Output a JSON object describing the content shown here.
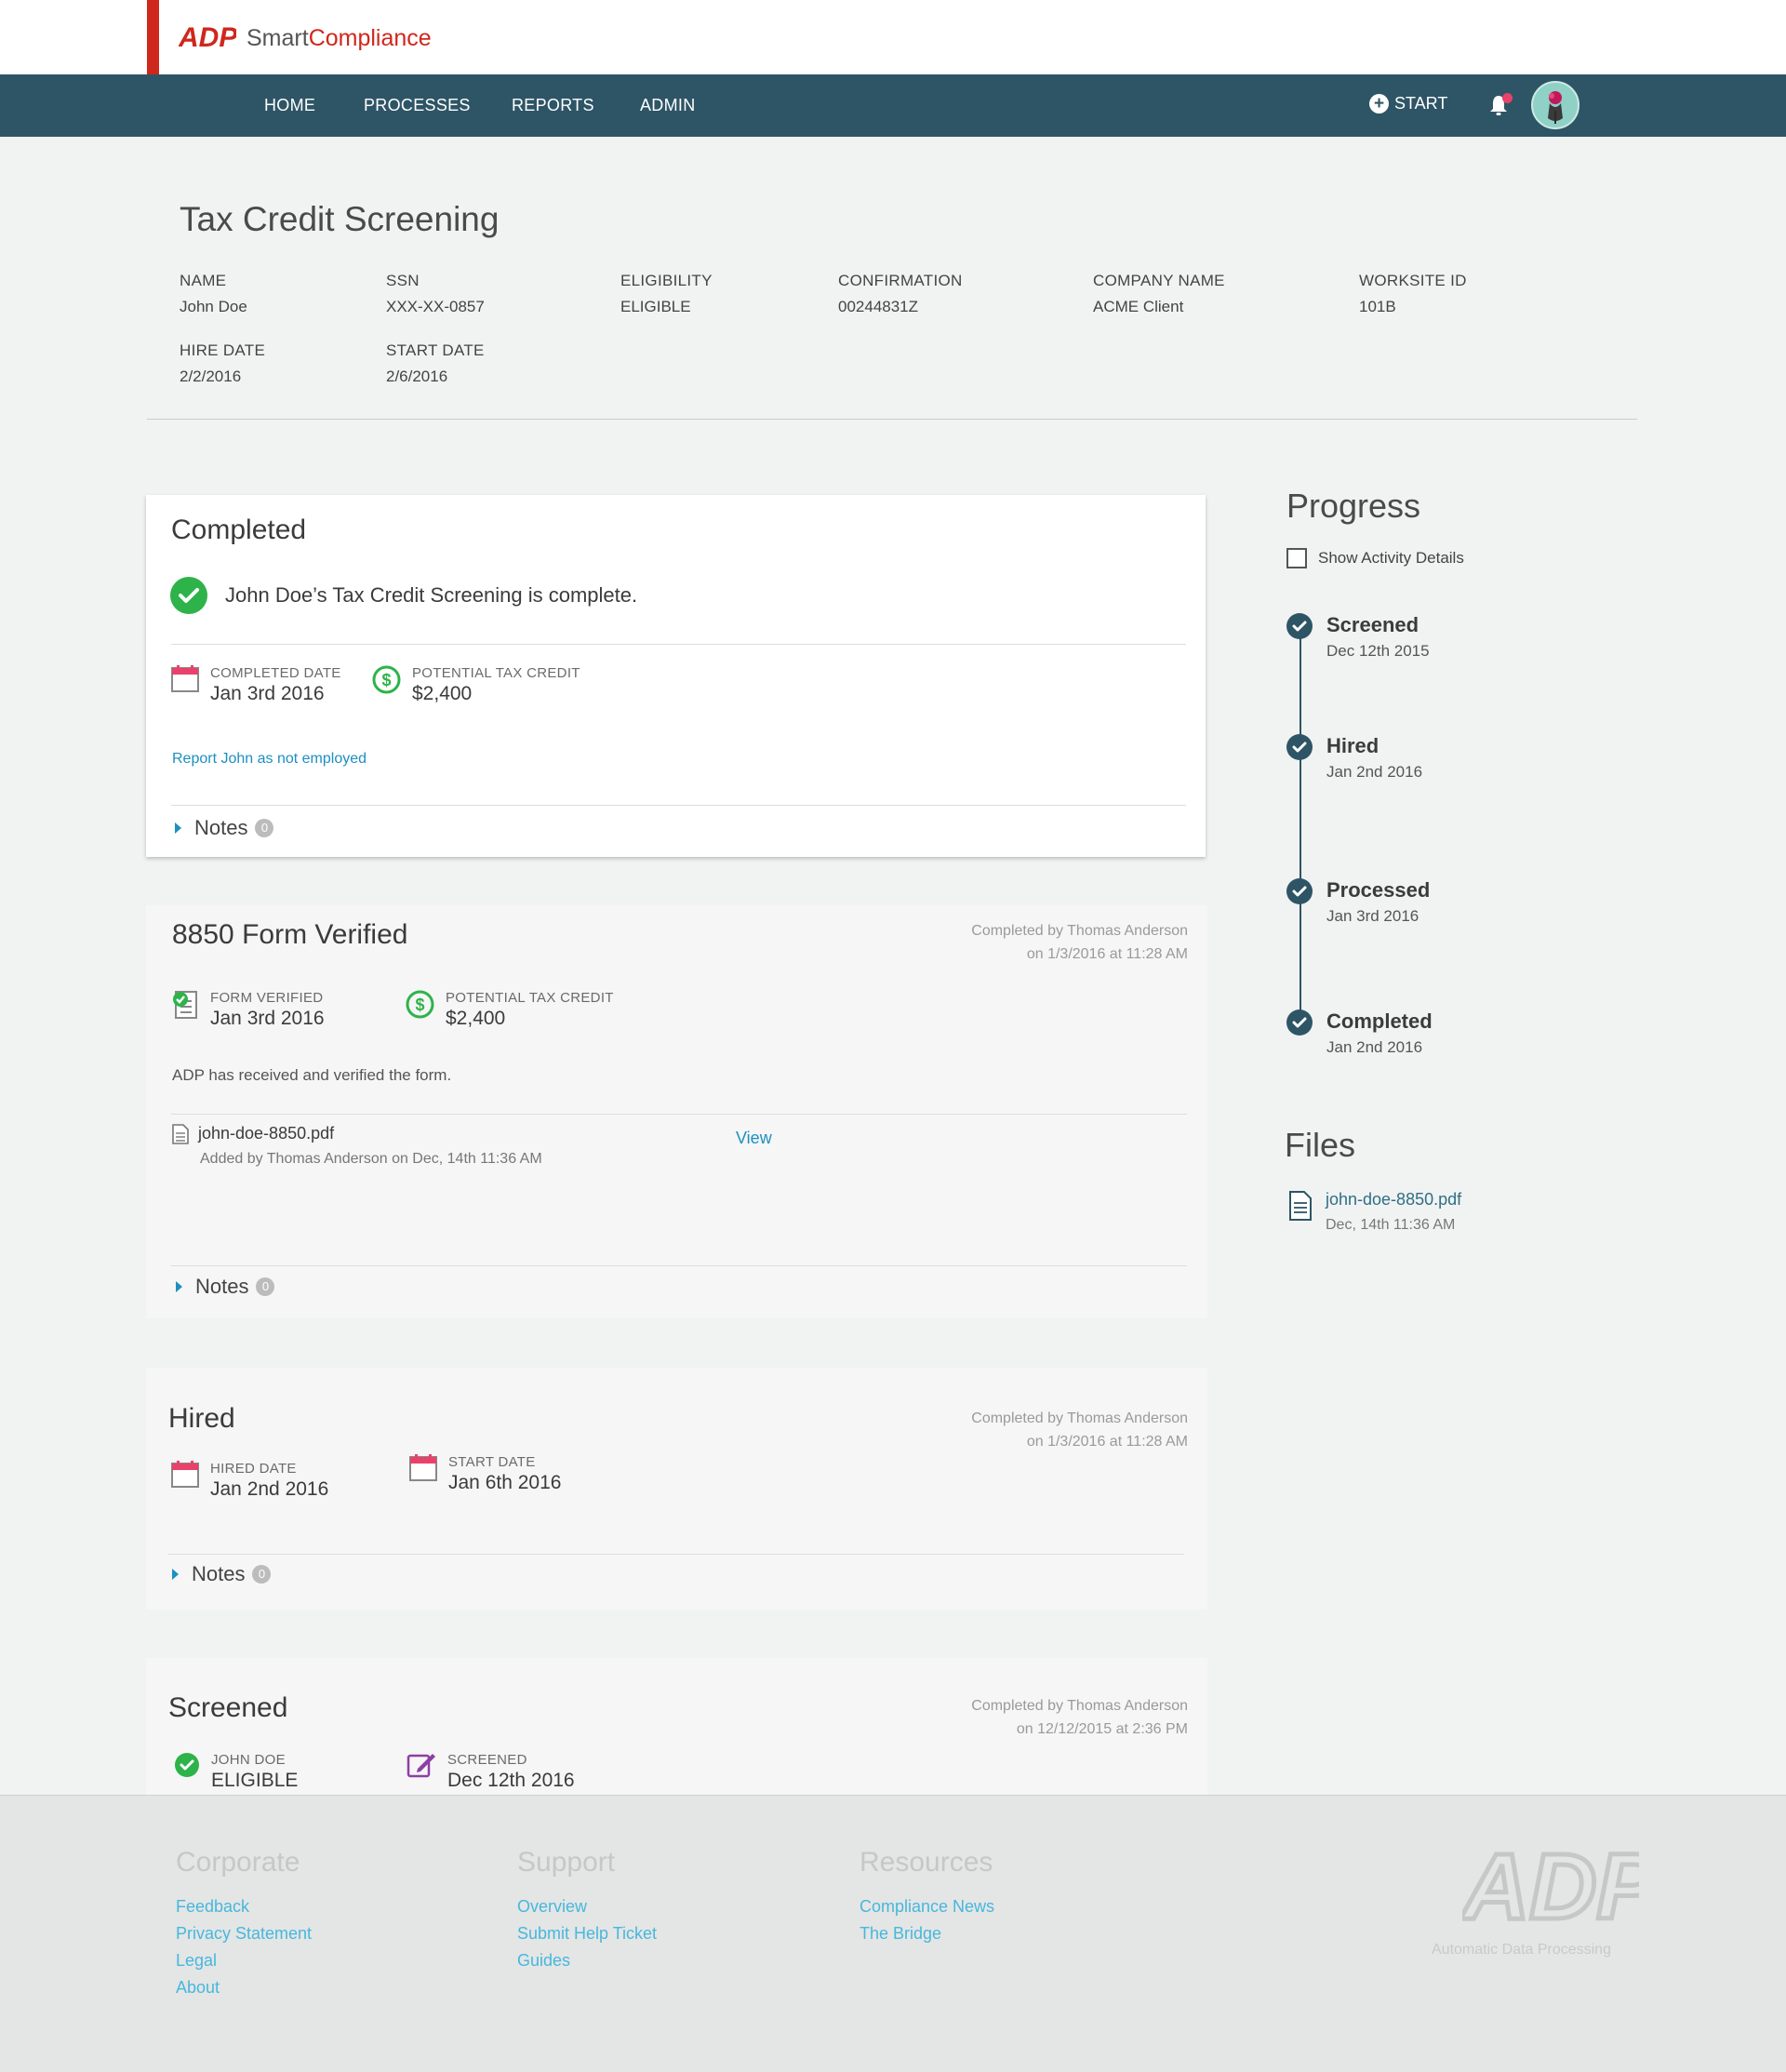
{
  "brand": {
    "prefix": "Smart",
    "accent": "Compliance",
    "logo": "ADP",
    "accent_color": "#d0271d"
  },
  "nav": {
    "items": [
      "HOME",
      "PROCESSES",
      "REPORTS",
      "ADMIN"
    ],
    "start_label": "START",
    "nav_color": "#2e5566"
  },
  "header": {
    "title": "Tax Credit Screening",
    "fields": [
      {
        "label": "NAME",
        "value": "John Doe"
      },
      {
        "label": "SSN",
        "value": "XXX-XX-0857"
      },
      {
        "label": "ELIGIBILITY",
        "value": "ELIGIBLE"
      },
      {
        "label": "CONFIRMATION",
        "value": "00244831Z"
      },
      {
        "label": "COMPANY NAME",
        "value": "ACME Client"
      },
      {
        "label": "WORKSITE ID",
        "value": "101B"
      },
      {
        "label": "HIRE DATE",
        "value": "2/2/2016"
      },
      {
        "label": "START DATE",
        "value": "2/6/2016"
      }
    ]
  },
  "completed_card": {
    "title": "Completed",
    "message": "John Doe’s Tax Credit Screening is complete.",
    "completed_date_label": "COMPLETED DATE",
    "completed_date": "Jan 3rd 2016",
    "tax_credit_label": "POTENTIAL TAX CREDIT",
    "tax_credit": "$2,400",
    "report_link": "Report John as not employed",
    "notes_label": "Notes",
    "notes_count": "0"
  },
  "form_card": {
    "title": "8850 Form Verified",
    "byline1": "Completed by Thomas Anderson",
    "byline2": "on 1/3/2016 at 11:28 AM",
    "verified_label": "FORM VERIFIED",
    "verified_date": "Jan 3rd 2016",
    "tax_credit_label": "POTENTIAL TAX CREDIT",
    "tax_credit": "$2,400",
    "message": "ADP has received and verified the form.",
    "file_name": "john-doe-8850.pdf",
    "file_added": "Added by Thomas Anderson on Dec, 14th 11:36 AM",
    "view_label": "View",
    "notes_label": "Notes",
    "notes_count": "0"
  },
  "hired_card": {
    "title": "Hired",
    "byline1": "Completed by Thomas Anderson",
    "byline2": "on 1/3/2016 at 11:28 AM",
    "hired_label": "HIRED DATE",
    "hired_date": "Jan 2nd 2016",
    "start_label": "START DATE",
    "start_date": "Jan 6th 2016",
    "notes_label": "Notes",
    "notes_count": "0"
  },
  "screened_card": {
    "title": "Screened",
    "byline1": "Completed by Thomas Anderson",
    "byline2": "on 12/12/2015 at 2:36 PM",
    "person_label": "JOHN DOE",
    "person_value": "ELIGIBLE",
    "screened_label": "SCREENED",
    "screened_date": "Dec 12th 2016"
  },
  "progress": {
    "title": "Progress",
    "checkbox_label": "Show Activity Details",
    "steps": [
      {
        "name": "Screened",
        "date": "Dec 12th 2015"
      },
      {
        "name": "Hired",
        "date": "Jan 2nd 2016"
      },
      {
        "name": "Processed",
        "date": "Jan 3rd 2016"
      },
      {
        "name": "Completed",
        "date": "Jan 2nd 2016"
      }
    ]
  },
  "files": {
    "title": "Files",
    "items": [
      {
        "name": "john-doe-8850.pdf",
        "date": "Dec, 14th 11:36 AM"
      }
    ]
  },
  "footer": {
    "corporate": {
      "title": "Corporate",
      "links": [
        "Feedback",
        "Privacy Statement",
        "Legal",
        "About"
      ]
    },
    "support": {
      "title": "Support",
      "links": [
        "Overview",
        "Submit Help Ticket",
        "Guides"
      ]
    },
    "resources": {
      "title": "Resources",
      "links": [
        "Compliance News",
        "The Bridge"
      ]
    },
    "logo": "ADP",
    "tagline": "Automatic Data Processing"
  }
}
